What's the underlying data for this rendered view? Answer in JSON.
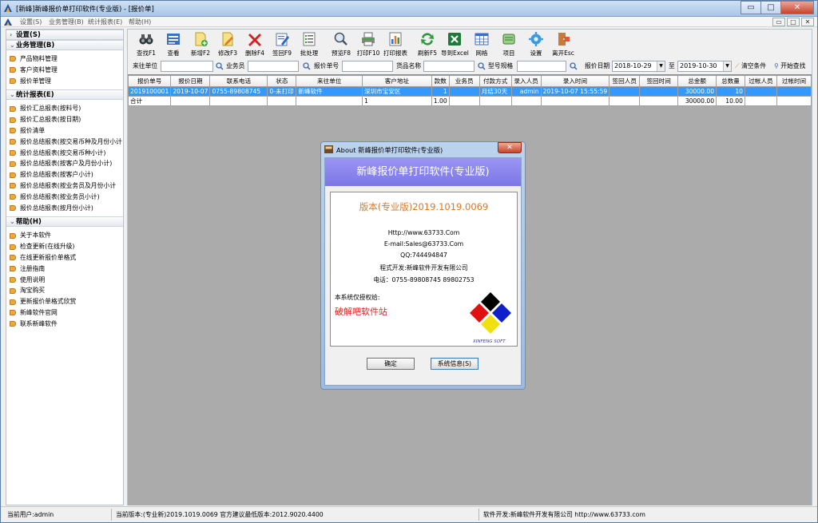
{
  "window": {
    "title": "[新峰]新峰报价单打印软件(专业版) - [报价单]",
    "controls": {
      "minimize": "▭",
      "maximize": "□",
      "close": "✕"
    }
  },
  "menubar": {
    "items": [
      "设置(S)",
      "业务管理(B)",
      "统计报表(E)",
      "帮助(H)"
    ],
    "mdi_controls": [
      "▭",
      "□",
      "✕"
    ]
  },
  "sidebar": {
    "sections": [
      {
        "title": "设置(S)",
        "items": []
      },
      {
        "title": "业务管理(B)",
        "items": [
          "产品物料管理",
          "客户资料管理",
          "报价单管理"
        ]
      },
      {
        "title": "统计报表(E)",
        "items": [
          "报价汇总报表(按料号)",
          "报价汇总报表(按日期)",
          "报价清单",
          "报价总结报表(按交易币种及月份小计",
          "报价总结报表(按交易币种小计)",
          "报价总结报表(按客户及月份小计)",
          "报价总结报表(按客户小计)",
          "报价总结报表(按业务员及月份小计",
          "报价总结报表(按业务员小计)",
          "报价总结报表(按月份小计)"
        ]
      },
      {
        "title": "帮助(H)",
        "items": [
          "关于本软件",
          "检查更新(在线升级)",
          "在线更新报价单格式",
          "注册指南",
          "使用说明",
          "淘宝购买",
          "更新报价单格式欣赏",
          "新峰软件官网",
          "联系新峰软件"
        ]
      }
    ]
  },
  "toolbar": {
    "buttons": [
      {
        "label": "查找F1",
        "icon": "binoculars-icon"
      },
      {
        "label": "查看",
        "icon": "view-icon"
      },
      {
        "label": "新增F2",
        "icon": "new-doc-icon"
      },
      {
        "label": "修改F3",
        "icon": "edit-icon"
      },
      {
        "label": "删除F4",
        "icon": "delete-icon"
      },
      {
        "label": "签回F9",
        "icon": "sign-icon"
      },
      {
        "label": "批处理",
        "icon": "batch-icon"
      },
      {
        "label": "预览F8",
        "icon": "preview-icon"
      },
      {
        "label": "打印F10",
        "icon": "print-icon"
      },
      {
        "label": "打印报表",
        "icon": "report-icon"
      },
      {
        "label": "刷新F5",
        "icon": "refresh-icon"
      },
      {
        "label": "导到Excel",
        "icon": "excel-icon"
      },
      {
        "label": "网格",
        "icon": "grid-icon"
      },
      {
        "label": "项目",
        "icon": "project-icon"
      },
      {
        "label": "设置",
        "icon": "gear-icon"
      },
      {
        "label": "离开Esc",
        "icon": "exit-icon"
      }
    ]
  },
  "search": {
    "customer_label": "来往单位",
    "salesman_label": "业务员",
    "quote_no_label": "报价单号",
    "product_label": "货品名称",
    "model_label": "型号规格",
    "date_label": "报价日期",
    "date_from": "2018-10-29",
    "date_to_label": "至",
    "date_to": "2019-10-30",
    "clear_label": "清空条件",
    "start_label": "开始查找"
  },
  "grid": {
    "columns": [
      "报价单号",
      "报价日期",
      "联系电话",
      "状态",
      "来往单位",
      "客户地址",
      "款数",
      "业务员",
      "付款方式",
      "录入人员",
      "录入时间",
      "签回人员",
      "签回时间",
      "总金额",
      "总数量",
      "过帐人员",
      "过帐时间"
    ],
    "rows": [
      [
        "2019100001",
        "2019-10-07",
        "0755-89808745",
        "0-未打印",
        "新峰软件",
        "深圳市宝安区",
        "1",
        "",
        "月结30天",
        "admin",
        "2019-10-07 15:55:59",
        "",
        "",
        "30000.00",
        "10",
        "",
        ""
      ]
    ],
    "totals": [
      "合计",
      "",
      "",
      "",
      "",
      "1",
      "1.00",
      "",
      "",
      "",
      "",
      "",
      "",
      "30000.00",
      "10.00",
      "",
      ""
    ]
  },
  "statusbar": {
    "user": "当前用户:admin",
    "version": "当前版本:(专业新)2019.1019.0069 官方建议最低版本:2012.9020.4400",
    "developer": "软件开发:新峰软件开发有限公司 http://www.63733.com"
  },
  "about_dialog": {
    "title": "About 新峰报价单打印软件(专业版)",
    "banner": "新峰报价单打印软件(专业版)",
    "version": "版本(专业版)2019.1019.0069",
    "url": "Http://www.63733.Com",
    "email": "E-mail:Sales@63733.Com",
    "qq": "QQ:744494847",
    "developer": "程式开发:新峰软件开发有限公司",
    "phone": "电话：0755-89808745   89802753",
    "license_label": "本系统仅授权给:",
    "licensee": "破解吧软件站",
    "logo_text": "XINFENG SOFT",
    "ok_label": "确定",
    "sysinfo_label": "系统信息(S)",
    "close": "✕"
  }
}
